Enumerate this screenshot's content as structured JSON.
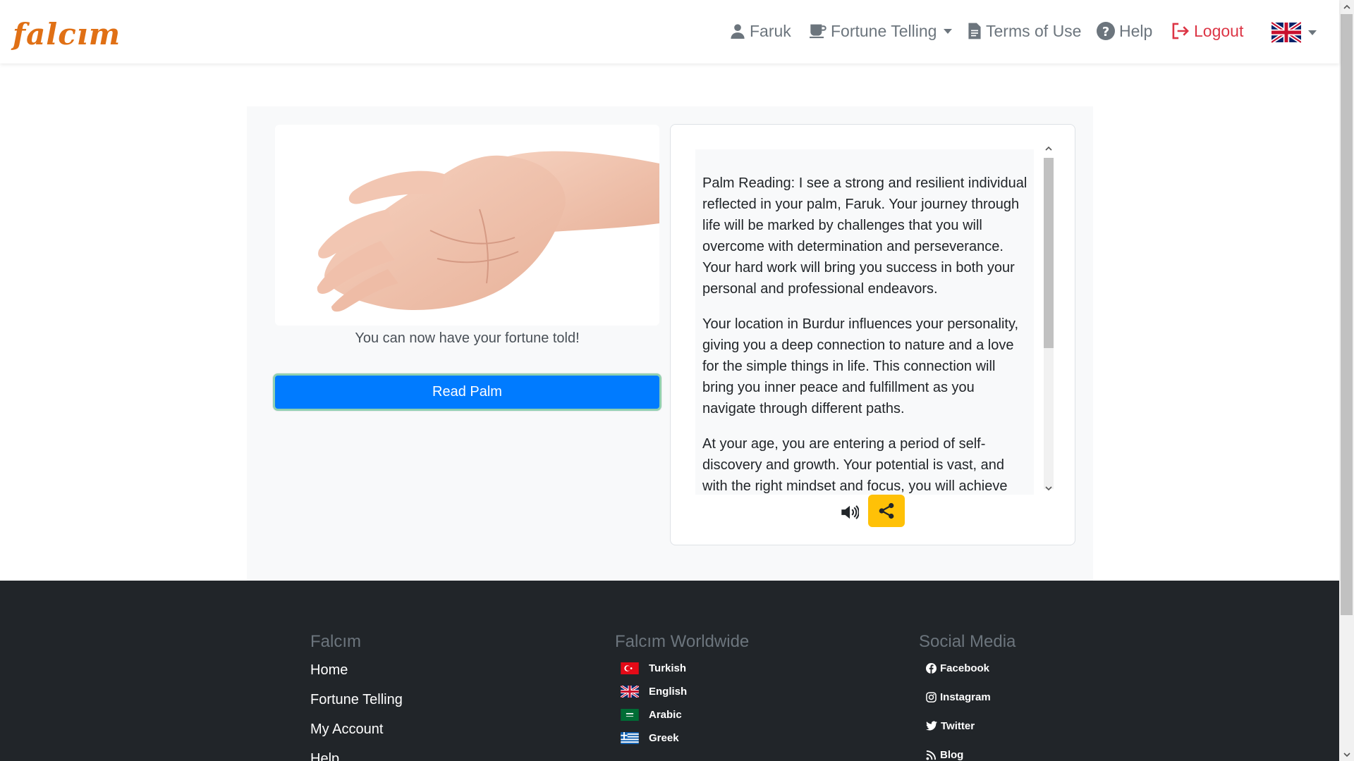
{
  "brand": "falcım",
  "nav": {
    "user": "Faruk",
    "fortune": "Fortune Telling",
    "terms": "Terms of Use",
    "help": "Help",
    "logout": "Logout"
  },
  "main": {
    "caption": "You can now have your fortune told!",
    "read_button": "Read Palm",
    "reading": [
      "Palm Reading: I see a strong and resilient individual reflected in your palm, Faruk. Your journey through life will be marked by challenges that you will overcome with determination and perseverance. Your hard work will bring you success in both your personal and professional endeavors.",
      "Your location in Burdur influences your personality, giving you a deep connection to nature and a love for the simple things in life. This connection will bring you inner peace and fulfillment as you navigate through different paths.",
      "At your age, you are entering a period of self-discovery and growth. Your potential is vast, and with the right mindset and focus, you will achieve"
    ]
  },
  "footer": {
    "col1": {
      "title": "Falcım",
      "links": [
        "Home",
        "Fortune Telling",
        "My Account",
        "Help"
      ]
    },
    "col2": {
      "title": "Falcım Worldwide",
      "langs": [
        "Turkish",
        "English",
        "Arabic",
        "Greek"
      ]
    },
    "col3": {
      "title": "Social Media",
      "links": [
        "Facebook",
        "Instagram",
        "Twitter",
        "Blog"
      ]
    }
  },
  "colors": {
    "primary": "#007bff",
    "accent": "#ffc107",
    "danger": "#dc3545",
    "brand": "#e07015",
    "footer_bg": "#212529"
  },
  "icons": [
    "user-icon",
    "cup-icon",
    "document-icon",
    "help-icon",
    "logout-icon",
    "uk-flag-icon",
    "speaker-icon",
    "share-icon",
    "facebook-icon",
    "instagram-icon",
    "twitter-icon",
    "rss-icon"
  ]
}
